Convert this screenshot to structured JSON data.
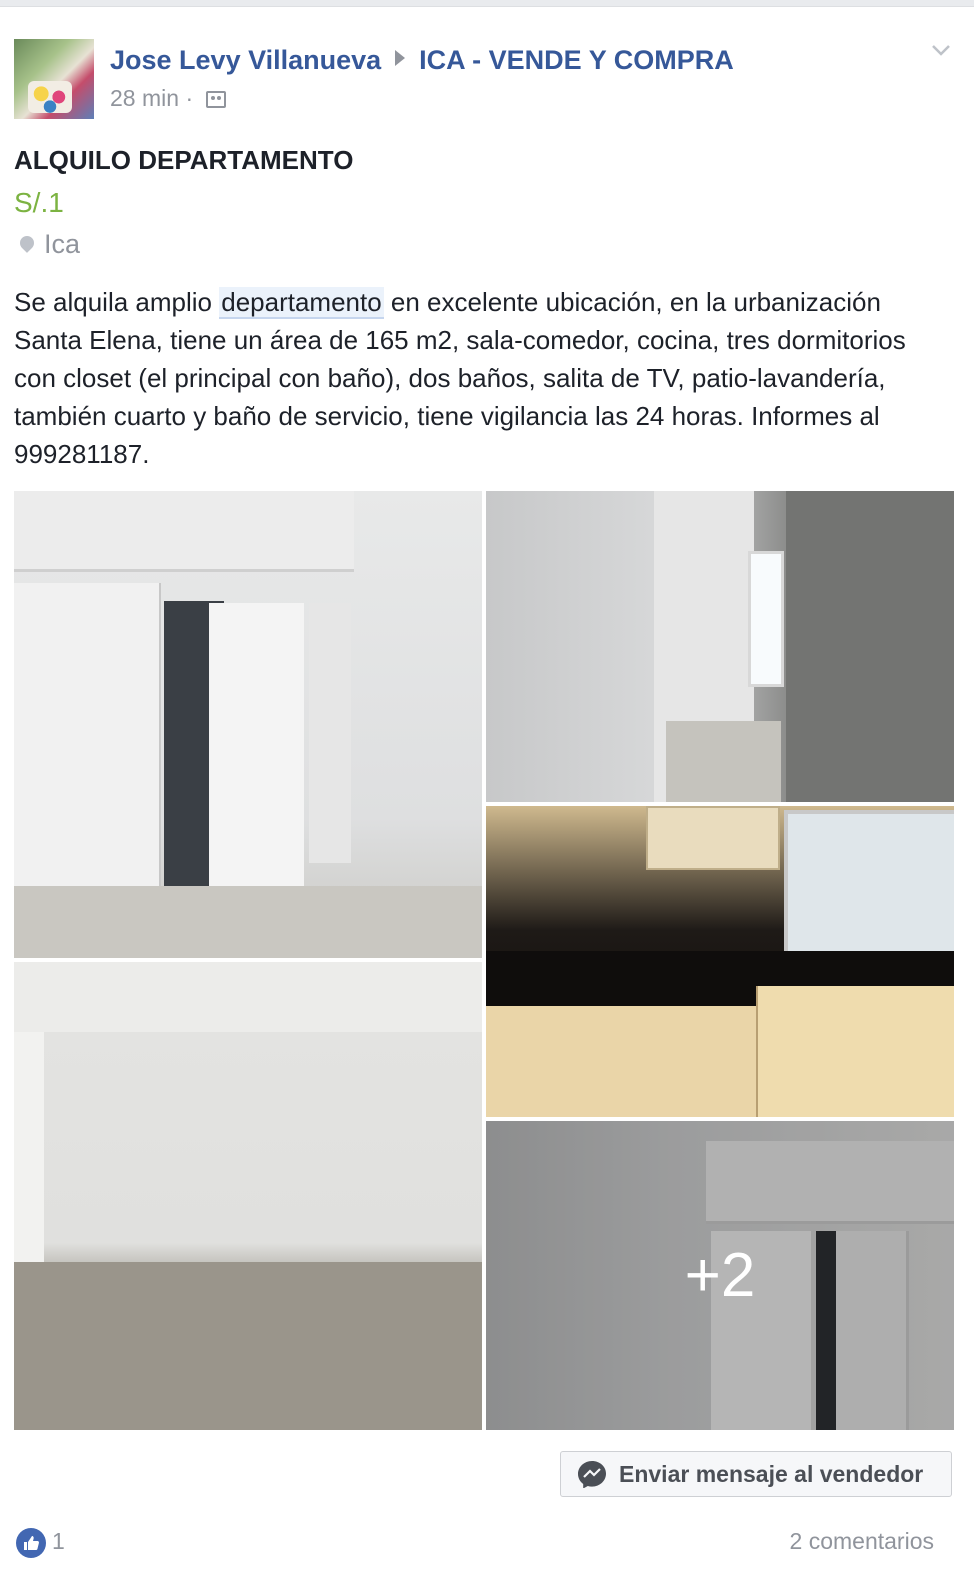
{
  "post": {
    "author": "Jose Levy Villanueva",
    "group": "ICA - VENDE Y COMPRA",
    "time": "28 min",
    "separator": "·",
    "title": "ALQUILO DEPARTAMENTO",
    "price": "S/.1",
    "location": "Ica",
    "description_before": "Se alquila amplio ",
    "description_highlight": "departamento",
    "description_after": " en excelente ubicación, en la urbanización Santa Elena, tiene un área de 165 m2, sala-comedor, cocina, tres dormitorios con closet (el principal con baño), dos baños, salita de TV, patio-lavandería, también cuarto y baño de servicio, tiene vigilancia las 24 horas. Informes al 999281187.",
    "more_photos": "+2",
    "message_button": "Enviar mensaje al vendedor",
    "like_count": "1",
    "comments": "2 comentarios"
  },
  "colors": {
    "link": "#365899",
    "price": "#7cb342",
    "muted": "#90949c",
    "like": "#4267b2"
  },
  "icons": [
    "group-icon",
    "chevron-down-icon",
    "location-pin-icon",
    "messenger-icon",
    "like-icon"
  ]
}
